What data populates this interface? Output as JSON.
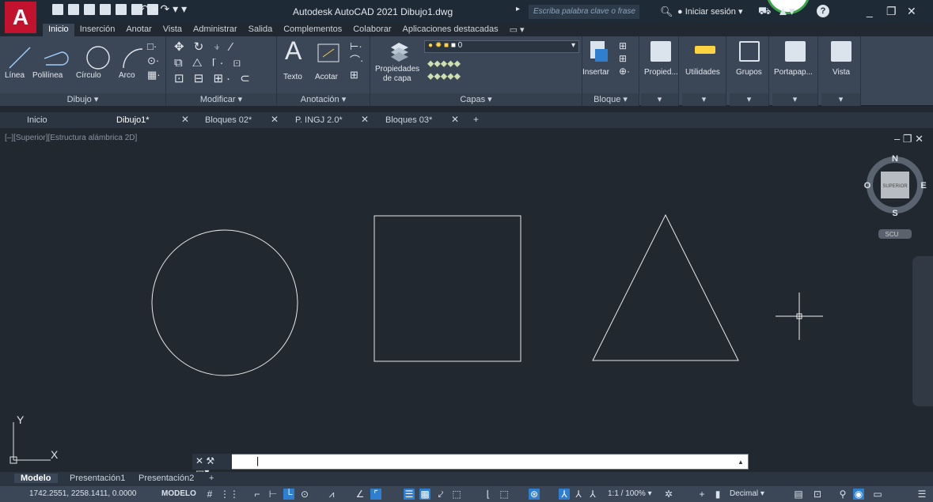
{
  "app": {
    "title": "Autodesk AutoCAD 2021   Dibujo1.dwg",
    "logo_letter": "A",
    "search_placeholder": "Escriba palabra clave o frase",
    "signin": "Iniciar sesión"
  },
  "ribbon_tabs": [
    "Inicio",
    "Inserción",
    "Anotar",
    "Vista",
    "Administrar",
    "Salida",
    "Complementos",
    "Colaborar",
    "Aplicaciones destacadas"
  ],
  "ribbon": {
    "draw": {
      "tools": [
        "Línea",
        "Polilínea",
        "Círculo",
        "Arco"
      ],
      "title": "Dibujo ▾"
    },
    "modify": {
      "title": "Modificar ▾"
    },
    "annotation": {
      "tools": [
        "Texto",
        "Acotar"
      ],
      "title": "Anotación ▾"
    },
    "layers": {
      "props_line1": "Propiedades",
      "props_line2": "de capa",
      "current_layer": "0",
      "title": "Capas ▾"
    },
    "block": {
      "tool": "Insertar",
      "title": "Bloque ▾"
    },
    "groups": [
      "Propied...",
      "Utilidades",
      "Grupos",
      "Portapap...",
      "Vista"
    ]
  },
  "doc_tabs": [
    "Inicio",
    "Dibujo1*",
    "Bloques 02*",
    "P. INGJ 2.0*",
    "Bloques 03*"
  ],
  "viewport": {
    "label": "[–][Superior][Estructura alámbrica 2D]",
    "viewcube": {
      "n": "N",
      "s": "S",
      "e": "E",
      "w": "O",
      "face": "SUPERIOR",
      "ucs": "SCU"
    },
    "ucs_axes": {
      "x": "X",
      "y": "Y"
    }
  },
  "layout_tabs": [
    "Modelo",
    "Presentación1",
    "Presentación2"
  ],
  "status": {
    "coords": "1742.2551, 2258.1411, 0.0000",
    "mode": "MODELO",
    "scale": "1:1 / 100% ▾",
    "units": "Decimal"
  }
}
